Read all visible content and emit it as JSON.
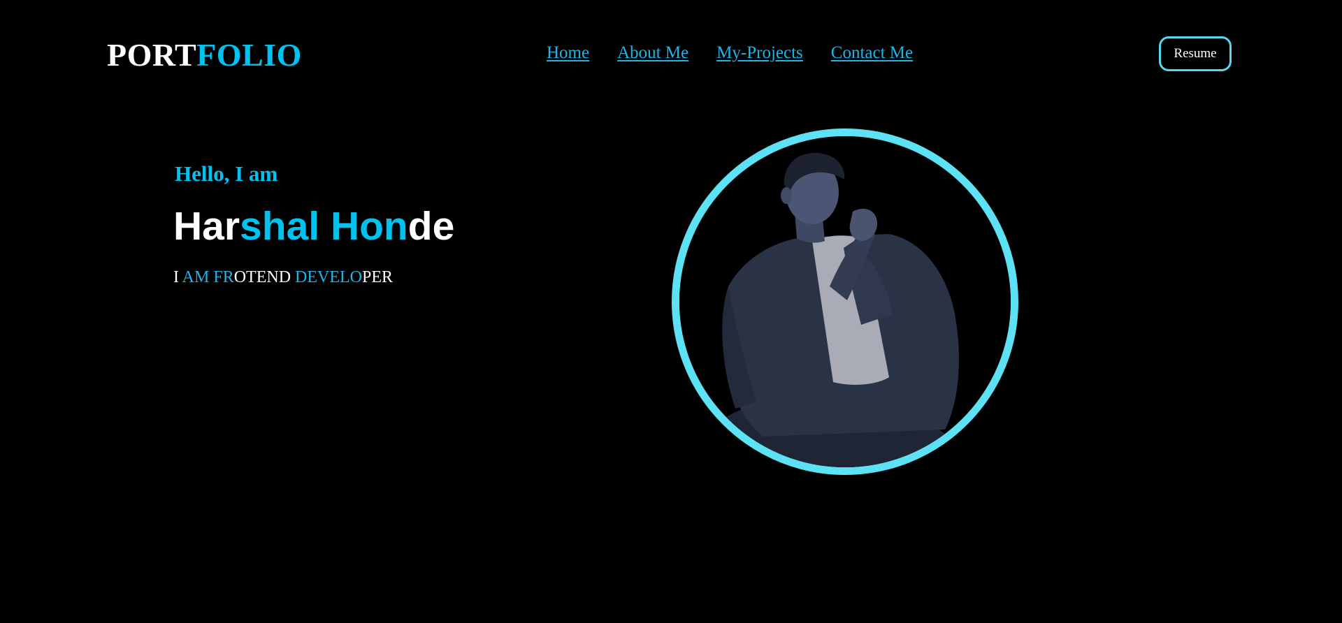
{
  "header": {
    "logo": {
      "part1": "PORT",
      "part2": "FOLIO"
    },
    "nav": [
      {
        "label": "Home"
      },
      {
        "label": "About Me"
      },
      {
        "label": "My-Projects"
      },
      {
        "label": "Contact Me"
      }
    ],
    "resume_label": "Resume"
  },
  "hero": {
    "greeting": "Hello, I am",
    "name": {
      "part1": "Har",
      "part2": "shal Hon",
      "part3": "de"
    },
    "role": {
      "p1": "I ",
      "p2": "AM FR",
      "p3": "OTEND ",
      "p4": "DEVELO",
      "p5": "PER"
    },
    "avatar_icon": "person-portrait"
  },
  "colors": {
    "background": "#000000",
    "accent": "#00c2f0",
    "link": "#1fb4e6",
    "ring": "#5ce1f5",
    "text": "#ffffff"
  }
}
